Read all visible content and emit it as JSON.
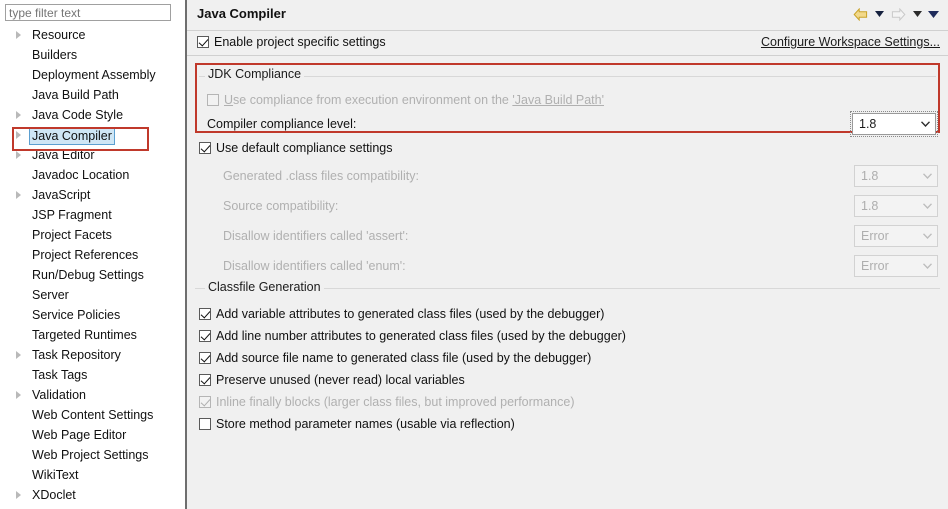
{
  "sidebar": {
    "filter": {
      "placeholder": "type filter text",
      "value": ""
    },
    "items": [
      {
        "label": "Resource",
        "expandable": true,
        "selected": false
      },
      {
        "label": "Builders",
        "expandable": false,
        "selected": false
      },
      {
        "label": "Deployment Assembly",
        "expandable": false,
        "selected": false
      },
      {
        "label": "Java Build Path",
        "expandable": false,
        "selected": false
      },
      {
        "label": "Java Code Style",
        "expandable": true,
        "selected": false
      },
      {
        "label": "Java Compiler",
        "expandable": true,
        "selected": true
      },
      {
        "label": "Java Editor",
        "expandable": true,
        "selected": false
      },
      {
        "label": "Javadoc Location",
        "expandable": false,
        "selected": false
      },
      {
        "label": "JavaScript",
        "expandable": true,
        "selected": false
      },
      {
        "label": "JSP Fragment",
        "expandable": false,
        "selected": false
      },
      {
        "label": "Project Facets",
        "expandable": false,
        "selected": false
      },
      {
        "label": "Project References",
        "expandable": false,
        "selected": false
      },
      {
        "label": "Run/Debug Settings",
        "expandable": false,
        "selected": false
      },
      {
        "label": "Server",
        "expandable": false,
        "selected": false
      },
      {
        "label": "Service Policies",
        "expandable": false,
        "selected": false
      },
      {
        "label": "Targeted Runtimes",
        "expandable": false,
        "selected": false
      },
      {
        "label": "Task Repository",
        "expandable": true,
        "selected": false
      },
      {
        "label": "Task Tags",
        "expandable": false,
        "selected": false
      },
      {
        "label": "Validation",
        "expandable": true,
        "selected": false
      },
      {
        "label": "Web Content Settings",
        "expandable": false,
        "selected": false
      },
      {
        "label": "Web Page Editor",
        "expandable": false,
        "selected": false
      },
      {
        "label": "Web Project Settings",
        "expandable": false,
        "selected": false
      },
      {
        "label": "WikiText",
        "expandable": false,
        "selected": false
      },
      {
        "label": "XDoclet",
        "expandable": true,
        "selected": false
      }
    ]
  },
  "header": {
    "title": "Java Compiler",
    "nav": {
      "back_icon": "back-arrow-icon",
      "back_menu_icon": "chevron-down-icon",
      "forward_icon": "forward-arrow-icon",
      "forward_menu_icon": "chevron-down-icon",
      "view_menu_icon": "chevron-down-icon"
    }
  },
  "enable_row": {
    "checkbox_label": "Enable project specific settings",
    "checked": true,
    "workspace_link": "Configure Workspace Settings..."
  },
  "jdk_compliance": {
    "group_title": "JDK Compliance",
    "use_execution_env": {
      "label_prefix": "U",
      "label": "se compliance from execution environment on the ",
      "link": "'Java Build Path'",
      "checked": false,
      "enabled": false
    },
    "compiler_level": {
      "label": "Compiler compliance level:",
      "value": "1.8",
      "enabled": true
    }
  },
  "default_compliance": {
    "checkbox_label": "Use default compliance settings",
    "checked": true,
    "rows": [
      {
        "label": "Generated .class files compatibility:",
        "value": "1.8",
        "enabled": false
      },
      {
        "label": "Source compatibility:",
        "value": "1.8",
        "enabled": false
      },
      {
        "label": "Disallow identifiers called 'assert':",
        "value": "Error",
        "enabled": false
      },
      {
        "label": "Disallow identifiers called 'enum':",
        "value": "Error",
        "enabled": false
      }
    ]
  },
  "classfile_generation": {
    "group_title": "Classfile Generation",
    "options": [
      {
        "label": "Add variable attributes to generated class files (used by the debugger)",
        "checked": true,
        "enabled": true
      },
      {
        "label": "Add line number attributes to generated class files (used by the debugger)",
        "checked": true,
        "enabled": true
      },
      {
        "label": "Add source file name to generated class file (used by the debugger)",
        "checked": true,
        "enabled": true
      },
      {
        "label": "Preserve unused (never read) local variables",
        "checked": true,
        "enabled": true
      },
      {
        "label": "Inline finally blocks (larger class files, but improved performance)",
        "checked": true,
        "enabled": false
      },
      {
        "label": "Store method parameter names (usable via reflection)",
        "checked": false,
        "enabled": true
      }
    ]
  },
  "colors": {
    "annotation_red": "#c0392b",
    "selection_blue": "#cfe6f5",
    "selection_border": "#5c9fd0",
    "panel_bg": "#f0f0f0",
    "back_arrow_yellow": "#e8c24a",
    "menu_chevron_navy": "#1f2b5b"
  }
}
